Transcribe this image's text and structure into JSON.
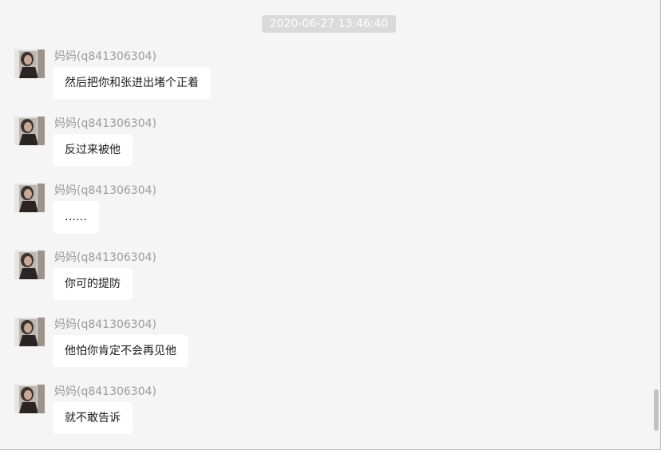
{
  "chat": {
    "timestamp": "2020-06-27 13:46:40",
    "messages": [
      {
        "sender": "妈妈(q841306304)",
        "text": "然后把你和张进出堵个正着"
      },
      {
        "sender": "妈妈(q841306304)",
        "text": "反过来被他"
      },
      {
        "sender": "妈妈(q841306304)",
        "text": "……"
      },
      {
        "sender": "妈妈(q841306304)",
        "text": "你可的提防"
      },
      {
        "sender": "妈妈(q841306304)",
        "text": "他怕你肯定不会再见他"
      },
      {
        "sender": "妈妈(q841306304)",
        "text": "就不敢告诉"
      }
    ]
  },
  "icons": {
    "avatar": "avatar-photo-icon"
  },
  "colors": {
    "background": "#f5f5f5",
    "bubble": "#ffffff",
    "sender": "#9b9b9b",
    "timestamp_bg": "#dadada"
  }
}
